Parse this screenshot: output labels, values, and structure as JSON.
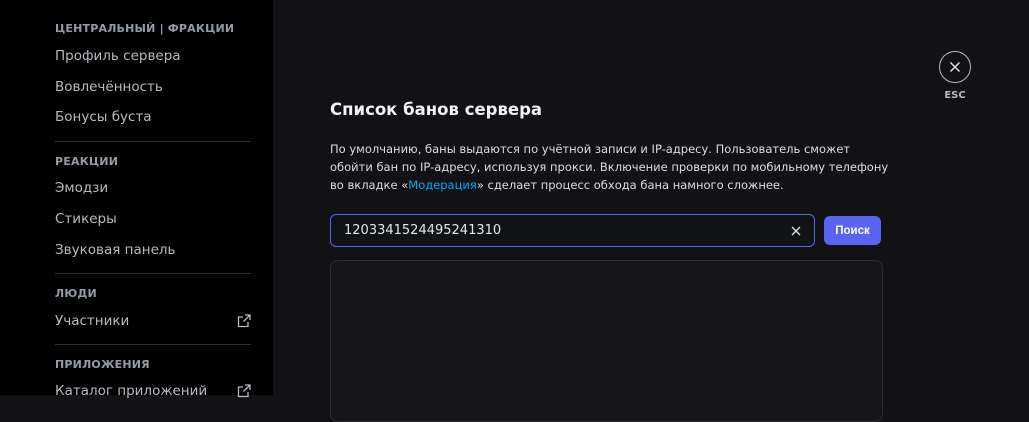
{
  "sidebar": {
    "sections": [
      {
        "header": "ЦЕНТРАЛЬНЫЙ | ФРАКЦИИ",
        "items": [
          "Профиль сервера",
          "Вовлечённость",
          "Бонусы буста"
        ]
      },
      {
        "header": "РЕАКЦИИ",
        "items": [
          "Эмодзи",
          "Стикеры",
          "Звуковая панель"
        ]
      },
      {
        "header": "ЛЮДИ",
        "items": [
          "Участники"
        ]
      },
      {
        "header": "ПРИЛОЖЕНИЯ",
        "items": [
          "Каталог приложений"
        ]
      }
    ]
  },
  "main": {
    "title": "Список банов сервера",
    "description_part1": "По умолчанию, баны выдаются по учётной записи и IP-адресу. Пользователь сможет обойти бан по IP-адресу, используя прокси. Включение проверки по мобильному телефону во вкладке «",
    "description_link": "Модерация",
    "description_part2": "» сделает процесс обхода бана намного сложнее.",
    "search_value": "1203341524495241310",
    "search_button": "Поиск"
  },
  "close": {
    "label": "ESC"
  },
  "colors": {
    "accent": "#5865f2",
    "link": "#00a8fc",
    "sidebar_bg": "#000000",
    "main_bg": "#121214"
  },
  "icons": {
    "external_link": "external-link-icon",
    "clear": "close-icon",
    "close": "close-icon"
  }
}
